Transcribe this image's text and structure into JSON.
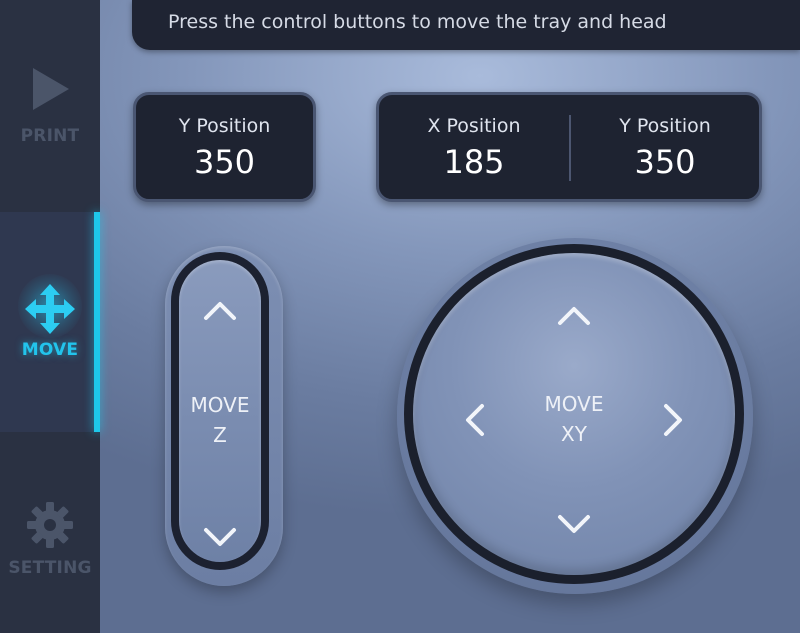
{
  "colors": {
    "sidebar_bg": "#2a3142",
    "accent": "#1ec8ea",
    "panel_bg": "#1e2331",
    "inactive_label": "#4b5569"
  },
  "sidebar": {
    "items": [
      {
        "label": "PRINT",
        "icon": "play-icon",
        "active": false
      },
      {
        "label": "MOVE",
        "icon": "move-arrows-icon",
        "active": true
      },
      {
        "label": "SETTING",
        "icon": "gear-icon",
        "active": false
      }
    ]
  },
  "message": {
    "text": "Press the control buttons to move the tray and head"
  },
  "positions": {
    "left_panel": {
      "title": "Y Position",
      "value": "350"
    },
    "x": {
      "title": "X Position",
      "value": "185"
    },
    "y": {
      "title": "Y Position",
      "value": "350"
    }
  },
  "move_z": {
    "line1": "MOVE",
    "line2": "Z",
    "up_icon": "chevron-up-icon",
    "down_icon": "chevron-down-icon"
  },
  "move_xy": {
    "line1": "MOVE",
    "line2": "XY",
    "up_icon": "chevron-up-icon",
    "down_icon": "chevron-down-icon",
    "left_icon": "chevron-left-icon",
    "right_icon": "chevron-right-icon"
  }
}
